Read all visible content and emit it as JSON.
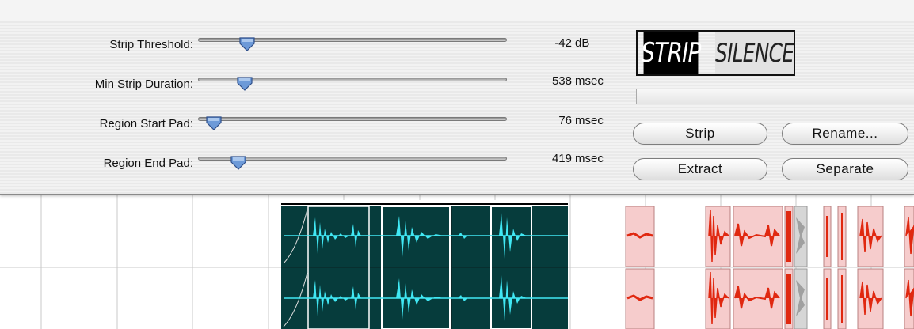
{
  "plugin": {
    "logo": {
      "left_text": "STRIP",
      "right_text": "SILENCE"
    },
    "sliders": [
      {
        "id": "strip-threshold",
        "label": "Strip Threshold:",
        "value": "-42",
        "unit": "dB",
        "fraction": 0.16
      },
      {
        "id": "min-strip-duration",
        "label": "Min Strip Duration:",
        "value": "538",
        "unit": "msec",
        "fraction": 0.15
      },
      {
        "id": "region-start-pad",
        "label": "Region Start Pad:",
        "value": "76",
        "unit": "msec",
        "fraction": 0.05
      },
      {
        "id": "region-end-pad",
        "label": "Region End Pad:",
        "value": "419",
        "unit": "msec",
        "fraction": 0.13
      }
    ],
    "buttons": {
      "strip": "Strip",
      "rename": "Rename...",
      "extract": "Extract",
      "separate": "Separate"
    },
    "progress": 0
  },
  "colors": {
    "selected_region_bg": "#063c3c",
    "selected_waveform": "#40e8f4",
    "region_bg": "#f6cccc",
    "region_waveform": "#e02810"
  }
}
